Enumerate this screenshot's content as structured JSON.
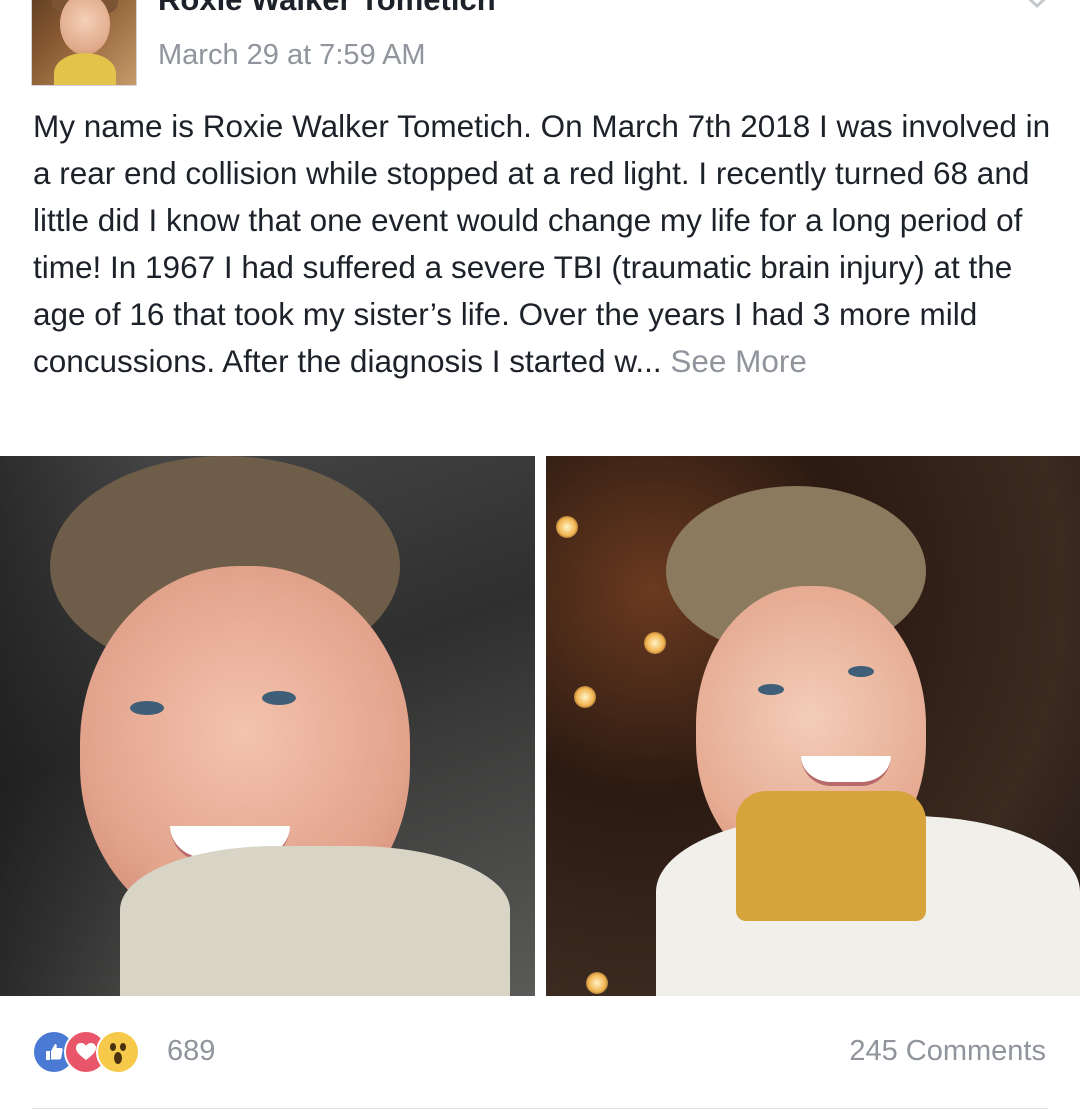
{
  "post": {
    "author": "Roxie Walker Tometich",
    "timestamp": "March 29 at 7:59 AM",
    "text": "My name is Roxie Walker Tometich.  On March 7th 2018 I was involved in a rear end collision while stopped at a red light. I recently turned 68 and little did I know that one event would change my life for a long period of time!  In 1967 I had suffered a severe TBI (traumatic brain injury) at the age of 16 that took my sister’s life. Over the years I had 3 more mild concussions. After the diagnosis I started w... ",
    "see_more": "See More"
  },
  "photos": [
    {
      "name": "selfie-photo"
    },
    {
      "name": "portrait-photo"
    }
  ],
  "footer": {
    "reaction_icons": [
      "like-icon",
      "love-icon",
      "wow-icon"
    ],
    "reaction_count": "689",
    "comments": "245 Comments"
  },
  "colors": {
    "text": "#1d2129",
    "secondary": "#90949c",
    "like": "#4a7ad3",
    "love": "#e9566a",
    "wow": "#f7c94a"
  }
}
